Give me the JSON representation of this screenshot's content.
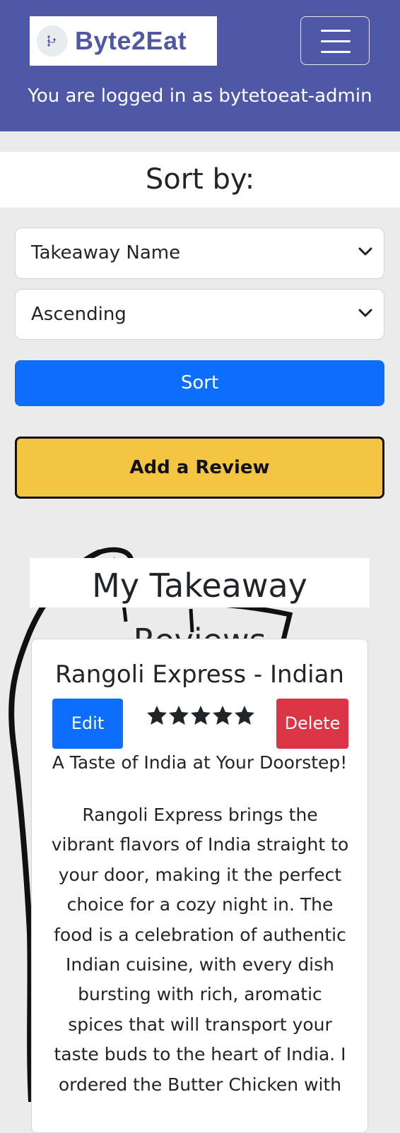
{
  "navbar": {
    "brand": "Byte2Eat",
    "logged_in_text": "You are logged in as bytetoeat-admin",
    "bg_color": "#4f58a6"
  },
  "sort": {
    "heading": "Sort by:",
    "field_value": "Takeaway Name",
    "order_value": "Ascending",
    "sort_button": "Sort"
  },
  "actions": {
    "add_review": "Add a Review"
  },
  "reviews": {
    "heading": "My Takeaway Reviews",
    "items": [
      {
        "title": "Rangoli Express - Indian",
        "edit_label": "Edit",
        "delete_label": "Delete",
        "rating": 5,
        "tagline": "A Taste of India at Your Doorstep!",
        "body": "Rangoli Express brings the vibrant flavors of India straight to your door, making it the perfect choice for a cozy night in. The food is a celebration of authentic Indian cuisine, with every dish bursting with rich, aromatic spices that will transport your taste buds to the heart of India. I ordered the Butter Chicken with"
      }
    ]
  },
  "icons": {
    "menu": "hamburger-icon",
    "chevron": "chevron-down-icon",
    "star": "star-icon"
  }
}
